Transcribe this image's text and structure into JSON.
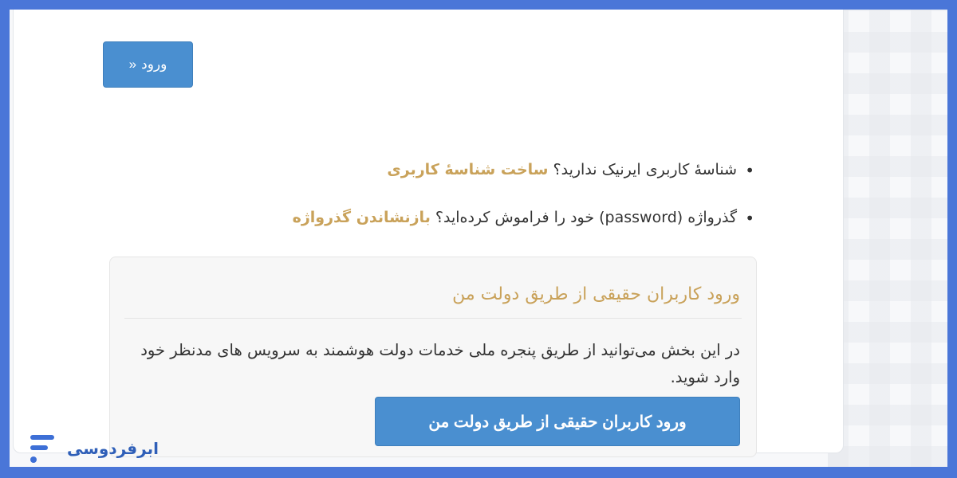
{
  "login_button": {
    "label": "ورود",
    "chevron": "«"
  },
  "links": {
    "no_account_text": "شناسهٔ کاربری ایرنیک ندارید؟",
    "create_account_link": "ساخت شناسهٔ کاربری",
    "forgot_password_text": "گذرواژه (password) خود را فراموش کرده‌اید؟",
    "reset_password_link": "بازنشاندن گذرواژه"
  },
  "gov_panel": {
    "title": "ورود کاربران حقیقی از طریق دولت من",
    "description": "در این بخش می‌توانید از طریق پنجره ملی خدمات دولت هوشمند به سرویس های مدنظر خود وارد شوید.",
    "button_label": "ورود کاربران حقیقی از طریق دولت من"
  },
  "brand": {
    "name": "ابرفردوسی",
    "icon": "brand-logo-icon"
  },
  "colors": {
    "frame": "#4a76d8",
    "primary_button": "#4a8fd0",
    "gold_link": "#c9a25a"
  }
}
